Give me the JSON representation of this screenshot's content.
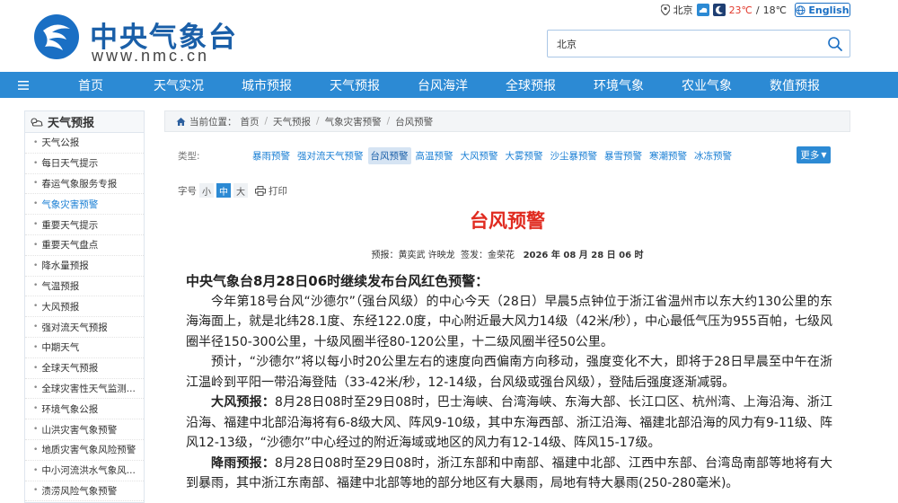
{
  "brand": {
    "name_cn": "中央气象台",
    "name_en": "www.nmc.cn"
  },
  "top_weather": {
    "city": "北京",
    "temp_high": "23℃",
    "sep": "/",
    "temp_low": "18℃"
  },
  "lang": {
    "label": "English"
  },
  "search": {
    "value": "北京"
  },
  "nav": {
    "items": [
      "首页",
      "天气实况",
      "城市预报",
      "天气预报",
      "台风海洋",
      "全球预报",
      "环境气象",
      "农业气象",
      "数值预报"
    ]
  },
  "sidebar": {
    "title": "天气预报",
    "items": [
      "天气公报",
      "每日天气提示",
      "春运气象服务专报",
      "气象灾害预警",
      "重要天气提示",
      "重要天气盘点",
      "降水量预报",
      "气温预报",
      "大风预报",
      "强对流天气预报",
      "中期天气",
      "全球天气预报",
      "全球灾害性天气监测...",
      "环境气象公报",
      "山洪灾害气象预警",
      "地质灾害气象风险预警",
      "中小河流洪水气象风...",
      "渍涝风险气象预警"
    ],
    "active_index": 3
  },
  "breadcrumb": {
    "label": "当前位置：",
    "items": [
      "首页",
      "天气预报",
      "气象灾害预警",
      "台风预警"
    ]
  },
  "types": {
    "label": "类型:",
    "items": [
      "暴雨预警",
      "强对流天气预警",
      "台风预警",
      "高温预警",
      "大风预警",
      "大雾预警",
      "沙尘暴预警",
      "暴雪预警",
      "寒潮预警",
      "冰冻预警"
    ],
    "active_index": 2,
    "more": "更多"
  },
  "tools": {
    "font_label": "字号",
    "sizes": [
      "小",
      "中",
      "大"
    ],
    "active_size": 1,
    "print": "打印"
  },
  "article": {
    "title": "台风预警",
    "meta": {
      "forecaster_label": "预报：",
      "forecasters": "黄奕武 许映龙",
      "approver_label": "签发：",
      "approver": "金荣花",
      "datetime": "2026 年 08 月 28 日 06 时"
    },
    "lead": "中央气象台8月28日06时继续发布台风红色预警：",
    "p1": "今年第18号台风“沙德尔”（强台风级）的中心今天（28日）早晨5点钟位于浙江省温州市以东大约130公里的东海海面上，就是北纬28.1度、东经122.0度，中心附近最大风力14级（42米/秒），中心最低气压为955百帕，七级风圈半径150-300公里，十级风圈半径80-120公里，十二级风圈半径50公里。",
    "p2": "预计，“沙德尔”将以每小时20公里左右的速度向西偏南方向移动，强度变化不大，即将于28日早晨至中午在浙江温岭到平阳一带沿海登陆（33-42米/秒，12-14级，台风级或强台风级），登陆后强度逐渐减弱。",
    "p3_label": "大风预报：",
    "p3": "8月28日08时至29日08时，巴士海峡、台湾海峡、东海大部、长江口区、杭州湾、上海沿海、浙江沿海、福建中北部沿海将有6-8级大风、阵风9-10级，其中东海西部、浙江沿海、福建北部沿海的风力有9-11级、阵风12-13级，“沙德尔”中心经过的附近海域或地区的风力有12-14级、阵风15-17级。",
    "p4_label": "降雨预报：",
    "p4": "8月28日08时至29日08时，浙江东部和中南部、福建中北部、江西中东部、台湾岛南部等地将有大到暴雨，其中浙江东南部、福建中北部等地的部分地区有大暴雨，局地有特大暴雨(250-280毫米)。"
  }
}
